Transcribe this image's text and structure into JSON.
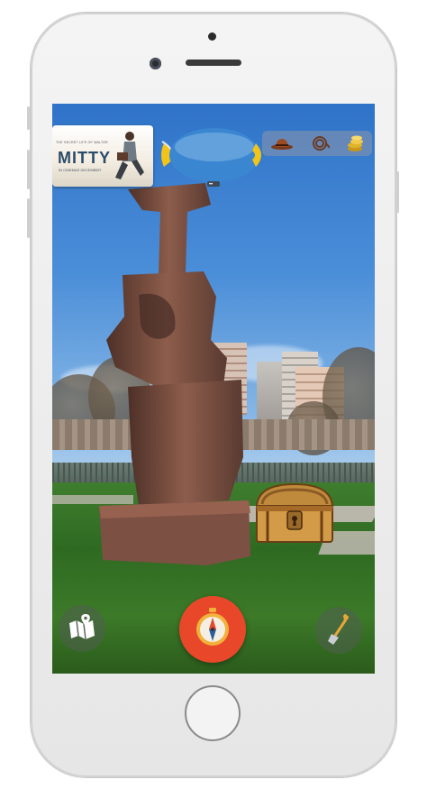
{
  "device": {
    "model": "white smartphone"
  },
  "ar_view": {
    "promo_card": {
      "tagline": "THE SECRET LIFE OF WALTER",
      "title": "MITTY",
      "subtitle": "IN CINEMAS DECEMBER"
    },
    "blimp_pages": "••",
    "top_icons": [
      {
        "name": "hat-icon"
      },
      {
        "name": "whip-icon"
      },
      {
        "name": "coins-icon"
      }
    ],
    "treasure_chest": {
      "icon": "treasure-chest-icon"
    },
    "bottom_bar": {
      "left": "map-icon",
      "center": "compass-icon",
      "right": "shovel-icon"
    }
  },
  "colors": {
    "compass_button": "#e8472a",
    "compass_ring": "#f1b13b",
    "blimp_body": "#3b86d1",
    "blimp_fins": "#f2c319",
    "icons_bg": "#8b94a8"
  }
}
